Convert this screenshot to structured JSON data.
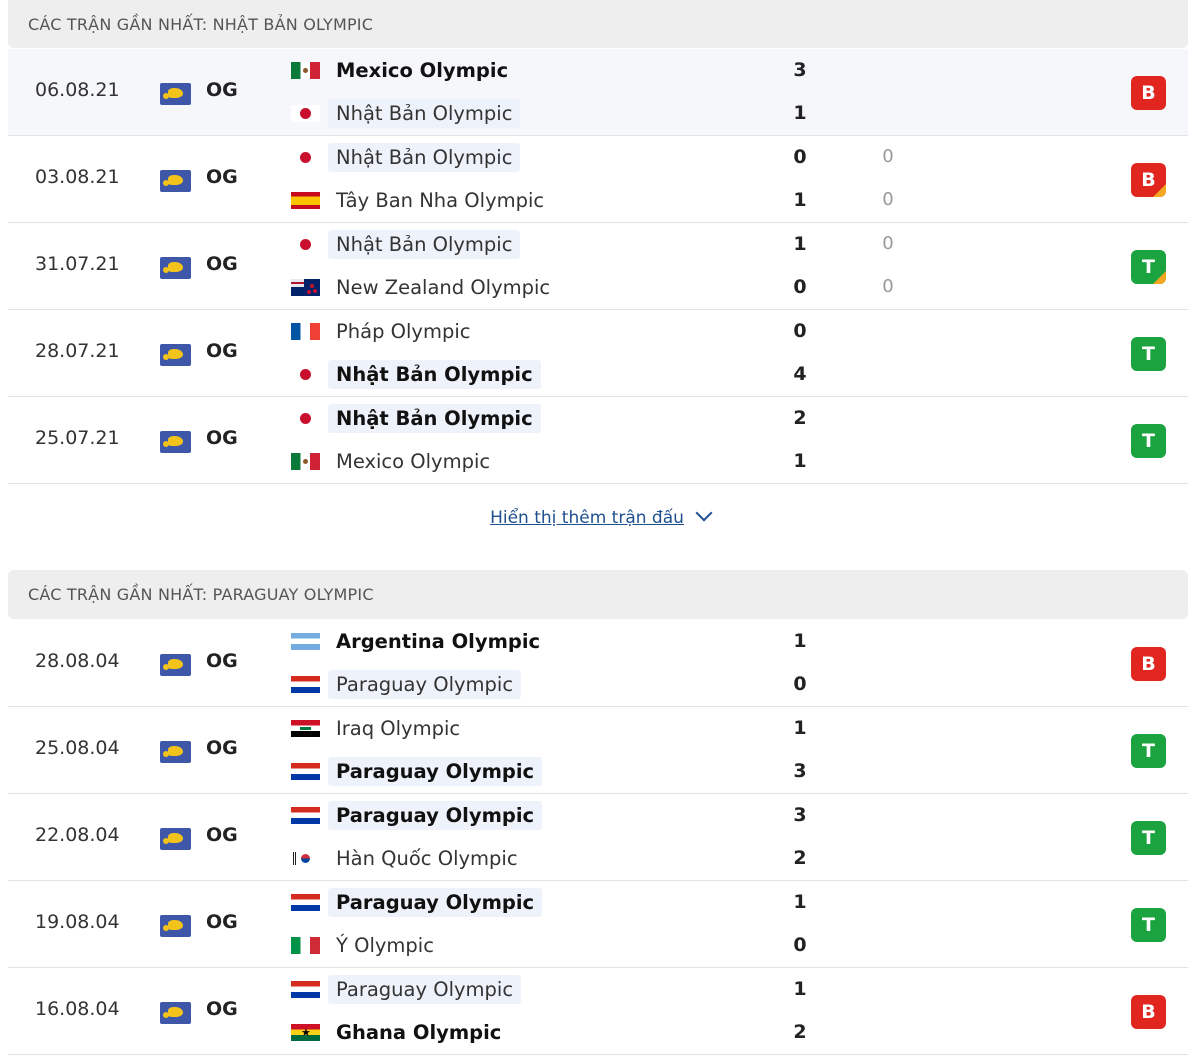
{
  "sections": [
    {
      "title": "CÁC TRẬN GẦN NHẤT: NHẬT BẢN OLYMPIC",
      "matches": [
        {
          "date": "06.08.21",
          "competition": "OG",
          "home": {
            "name": "Mexico Olympic",
            "flag": "mexico-flag-icon",
            "bold": true,
            "highlight": false
          },
          "away": {
            "name": "Nhật Bản Olympic",
            "flag": "japan-flag-icon",
            "bold": false,
            "highlight": true
          },
          "home_score": "3",
          "away_score": "1",
          "home_pen": "",
          "away_pen": "",
          "result": "B",
          "result_corner": false
        },
        {
          "date": "03.08.21",
          "competition": "OG",
          "home": {
            "name": "Nhật Bản Olympic",
            "flag": "japan-flag-icon",
            "bold": false,
            "highlight": true
          },
          "away": {
            "name": "Tây Ban Nha Olympic",
            "flag": "spain-flag-icon",
            "bold": false,
            "highlight": false
          },
          "home_score": "0",
          "away_score": "1",
          "home_pen": "0",
          "away_pen": "0",
          "result": "B",
          "result_corner": true
        },
        {
          "date": "31.07.21",
          "competition": "OG",
          "home": {
            "name": "Nhật Bản Olympic",
            "flag": "japan-flag-icon",
            "bold": false,
            "highlight": true
          },
          "away": {
            "name": "New Zealand Olympic",
            "flag": "new-zealand-flag-icon",
            "bold": false,
            "highlight": false
          },
          "home_score": "1",
          "away_score": "0",
          "home_pen": "0",
          "away_pen": "0",
          "result": "T",
          "result_corner": true
        },
        {
          "date": "28.07.21",
          "competition": "OG",
          "home": {
            "name": "Pháp Olympic",
            "flag": "france-flag-icon",
            "bold": false,
            "highlight": false
          },
          "away": {
            "name": "Nhật Bản Olympic",
            "flag": "japan-flag-icon",
            "bold": true,
            "highlight": true
          },
          "home_score": "0",
          "away_score": "4",
          "home_pen": "",
          "away_pen": "",
          "result": "T",
          "result_corner": false
        },
        {
          "date": "25.07.21",
          "competition": "OG",
          "home": {
            "name": "Nhật Bản Olympic",
            "flag": "japan-flag-icon",
            "bold": true,
            "highlight": true
          },
          "away": {
            "name": "Mexico Olympic",
            "flag": "mexico-flag-icon",
            "bold": false,
            "highlight": false
          },
          "home_score": "2",
          "away_score": "1",
          "home_pen": "",
          "away_pen": "",
          "result": "T",
          "result_corner": false
        }
      ]
    },
    {
      "title": "CÁC TRẬN GẦN NHẤT: PARAGUAY OLYMPIC",
      "matches": [
        {
          "date": "28.08.04",
          "competition": "OG",
          "home": {
            "name": "Argentina Olympic",
            "flag": "argentina-flag-icon",
            "bold": true,
            "highlight": false
          },
          "away": {
            "name": "Paraguay Olympic",
            "flag": "paraguay-flag-icon",
            "bold": false,
            "highlight": true
          },
          "home_score": "1",
          "away_score": "0",
          "home_pen": "",
          "away_pen": "",
          "result": "B",
          "result_corner": false
        },
        {
          "date": "25.08.04",
          "competition": "OG",
          "home": {
            "name": "Iraq Olympic",
            "flag": "iraq-flag-icon",
            "bold": false,
            "highlight": false
          },
          "away": {
            "name": "Paraguay Olympic",
            "flag": "paraguay-flag-icon",
            "bold": true,
            "highlight": true
          },
          "home_score": "1",
          "away_score": "3",
          "home_pen": "",
          "away_pen": "",
          "result": "T",
          "result_corner": false
        },
        {
          "date": "22.08.04",
          "competition": "OG",
          "home": {
            "name": "Paraguay Olympic",
            "flag": "paraguay-flag-icon",
            "bold": true,
            "highlight": true
          },
          "away": {
            "name": "Hàn Quốc Olympic",
            "flag": "south-korea-flag-icon",
            "bold": false,
            "highlight": false
          },
          "home_score": "3",
          "away_score": "2",
          "home_pen": "",
          "away_pen": "",
          "result": "T",
          "result_corner": false
        },
        {
          "date": "19.08.04",
          "competition": "OG",
          "home": {
            "name": "Paraguay Olympic",
            "flag": "paraguay-flag-icon",
            "bold": true,
            "highlight": true
          },
          "away": {
            "name": "Ý Olympic",
            "flag": "italy-flag-icon",
            "bold": false,
            "highlight": false
          },
          "home_score": "1",
          "away_score": "0",
          "home_pen": "",
          "away_pen": "",
          "result": "T",
          "result_corner": false
        },
        {
          "date": "16.08.04",
          "competition": "OG",
          "home": {
            "name": "Paraguay Olympic",
            "flag": "paraguay-flag-icon",
            "bold": false,
            "highlight": true
          },
          "away": {
            "name": "Ghana Olympic",
            "flag": "ghana-flag-icon",
            "bold": true,
            "highlight": false
          },
          "home_score": "1",
          "away_score": "2",
          "home_pen": "",
          "away_pen": "",
          "result": "B",
          "result_corner": false
        }
      ]
    }
  ],
  "show_more": {
    "label": "Hiển thị thêm trận đấu",
    "icon": "chevron-down-icon"
  },
  "competition_icon": "olympic-games-icon",
  "colors": {
    "loss": "#e0261f",
    "win": "#1aa33e",
    "extra_time": "#f5a623",
    "link": "#1f4f8f"
  }
}
